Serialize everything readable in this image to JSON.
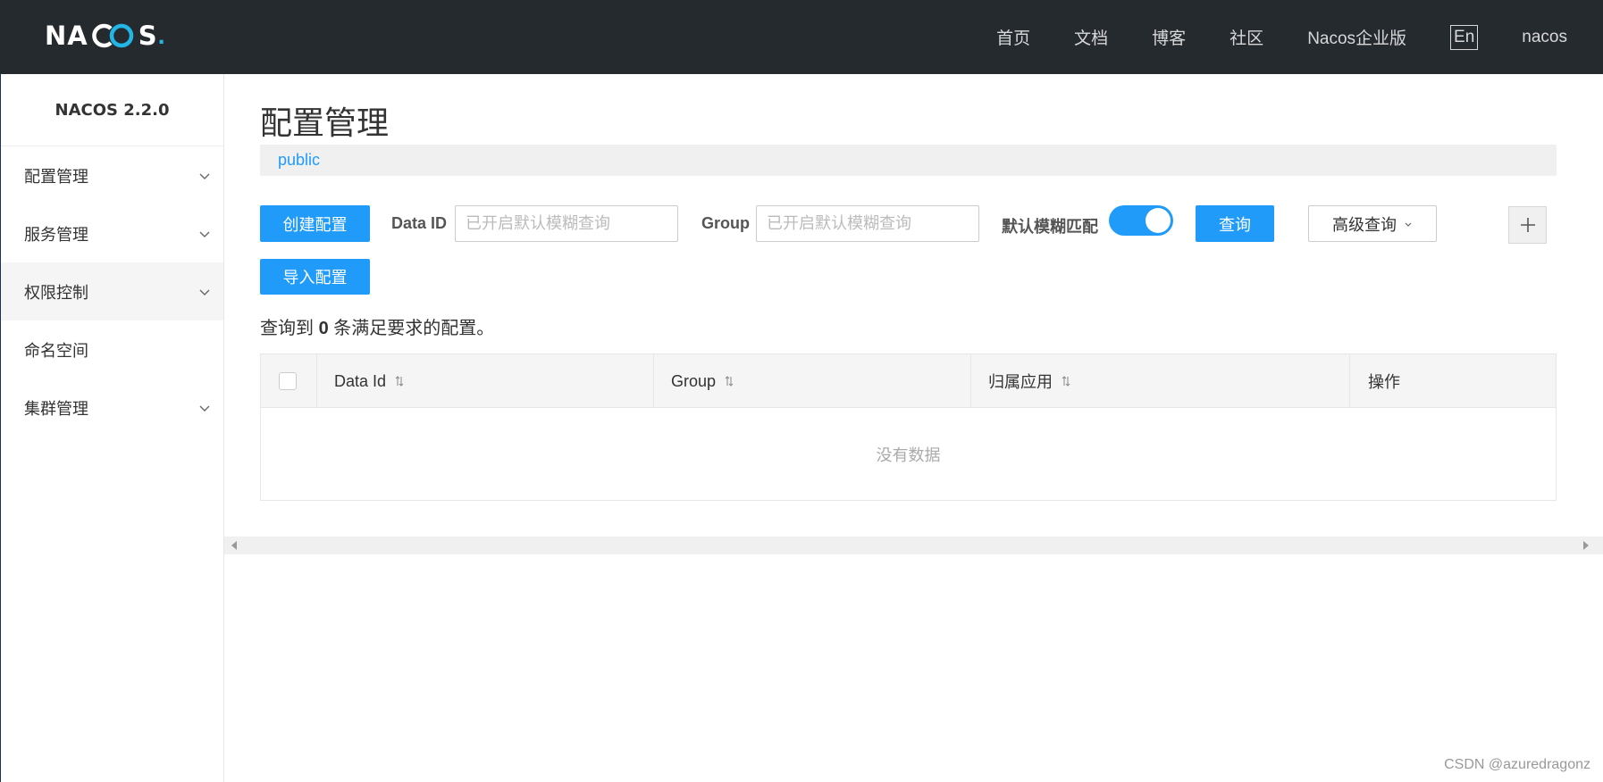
{
  "header": {
    "logo": {
      "prefix": "NA",
      "suffix": "S",
      "dot": "."
    },
    "nav": [
      {
        "label": "首页"
      },
      {
        "label": "文档"
      },
      {
        "label": "博客"
      },
      {
        "label": "社区"
      },
      {
        "label": "Nacos企业版"
      }
    ],
    "lang": "En",
    "user": "nacos"
  },
  "sidebar": {
    "title": "NACOS 2.2.0",
    "items": [
      {
        "label": "配置管理",
        "expandable": true
      },
      {
        "label": "服务管理",
        "expandable": true
      },
      {
        "label": "权限控制",
        "expandable": true,
        "active": true
      },
      {
        "label": "命名空间",
        "expandable": false
      },
      {
        "label": "集群管理",
        "expandable": true
      }
    ]
  },
  "main": {
    "title": "配置管理",
    "namespace": "public",
    "toolbar": {
      "create_label": "创建配置",
      "data_id_label": "Data ID",
      "data_id_placeholder": "已开启默认模糊查询",
      "group_label": "Group",
      "group_placeholder": "已开启默认模糊查询",
      "fuzzy_label": "默认模糊匹配",
      "fuzzy_on": true,
      "query_label": "查询",
      "advanced_label": "高级查询",
      "import_label": "导入配置"
    },
    "result": {
      "prefix": "查询到",
      "count": "0",
      "suffix": "条满足要求的配置。"
    },
    "table": {
      "columns": [
        "Data Id",
        "Group",
        "归属应用",
        "操作"
      ],
      "empty_text": "没有数据"
    }
  },
  "watermark": "CSDN @azuredragonz",
  "colors": {
    "primary": "#209bfa",
    "header_bg": "#252a2f",
    "logo_accent": "#22b6e6"
  }
}
